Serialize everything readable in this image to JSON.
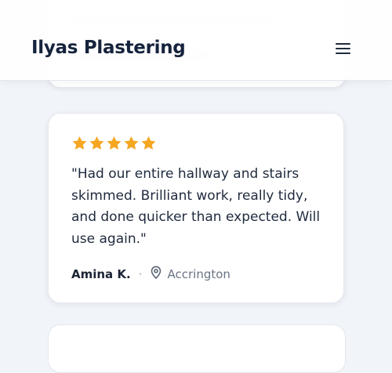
{
  "header": {
    "brand": "Ilyas Plastering",
    "menu_icon": "hamburger-menu-icon"
  },
  "review": {
    "rating": 5,
    "max_rating": 5,
    "star_color": "#f5a623",
    "quote": "\"Had our entire hallway and stairs skimmed. Brilliant work, really tidy, and done quicker than expected. Will use again.\"",
    "author": "Amina K.",
    "separator": "·",
    "location": "Accrington",
    "location_icon": "map-pin-icon"
  }
}
